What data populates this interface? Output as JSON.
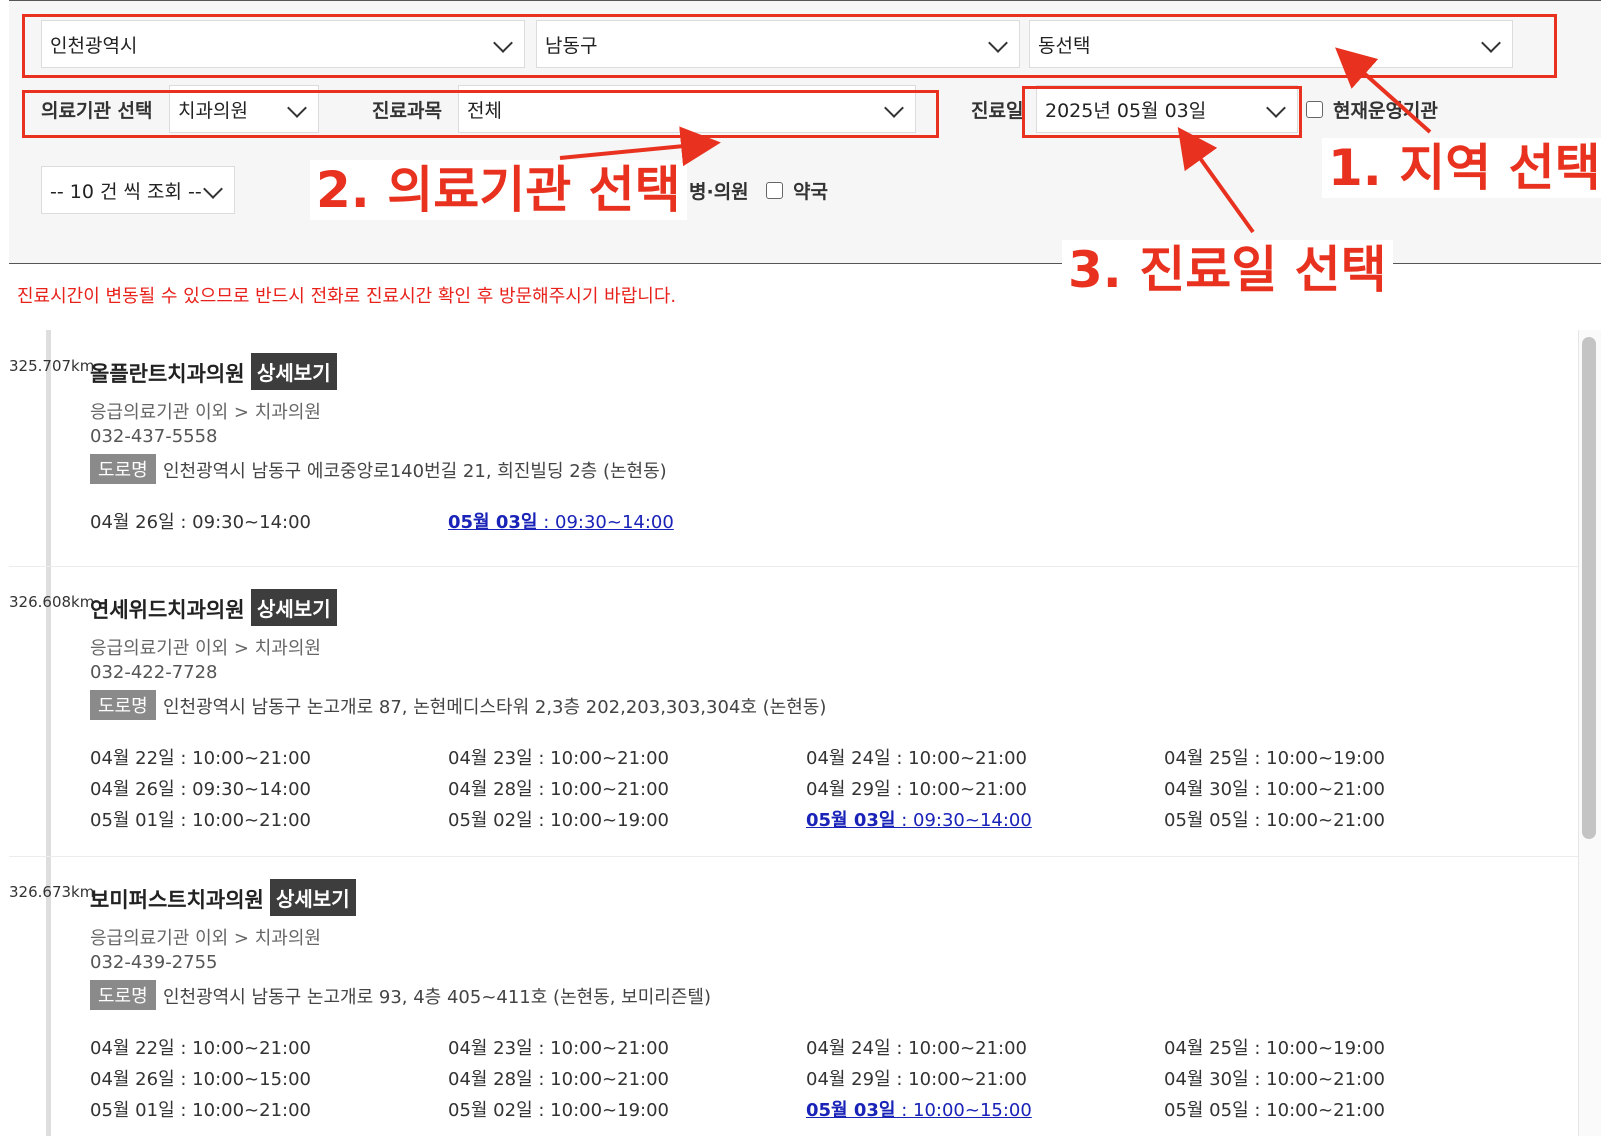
{
  "filters": {
    "city": "인천광역시",
    "district": "남동구",
    "dong": "동선택",
    "institution_label": "의료기관 선택",
    "institution": "치과의원",
    "subject_label": "진료과목",
    "subject": "전체",
    "date_label": "진료일",
    "date": "2025년 05월 03일",
    "open_now_label": "현재운영기관",
    "page_size": "-- 10 건 씩 조회 --",
    "clinic_label": "병·의원",
    "pharmacy_label": "약국"
  },
  "annotations": {
    "step1": "1. 지역 선택",
    "step2": "2. 의료기관 선택",
    "step3": "3. 진료일 선택"
  },
  "notice": "진료시간이 변동될 수 있으므로 반드시 전화로 진료시간 확인 후 방문해주시기 바랍니다.",
  "colors": {
    "annotation": "#e8321f",
    "notice": "#e8211b",
    "today_link": "#1a23b8",
    "checkbox": "#1a73e8"
  },
  "detail_label": "상세보기",
  "road_label": "도로명",
  "items": [
    {
      "distance": "325.707km",
      "name": "올플란트치과의원",
      "category": "응급의료기관 이외 > 치과의원",
      "phone": "032-437-5558",
      "address": "인천광역시 남동구 에코중앙로140번길 21, 희진빌딩 2층 (논현동)",
      "hours": [
        {
          "day": "04월 26일",
          "time": " : 09:30~14:00",
          "today": false
        },
        {
          "day": "05월 03일",
          "time": " : 09:30~14:00",
          "today": true
        }
      ]
    },
    {
      "distance": "326.608km",
      "name": "연세위드치과의원",
      "category": "응급의료기관 이외 > 치과의원",
      "phone": "032-422-7728",
      "address": "인천광역시 남동구 논고개로 87, 논현메디스타워 2,3층 202,203,303,304호 (논현동)",
      "hours": [
        {
          "day": "04월 22일",
          "time": " : 10:00~21:00",
          "today": false
        },
        {
          "day": "04월 23일",
          "time": " : 10:00~21:00",
          "today": false
        },
        {
          "day": "04월 24일",
          "time": " : 10:00~21:00",
          "today": false
        },
        {
          "day": "04월 25일",
          "time": " : 10:00~19:00",
          "today": false
        },
        {
          "day": "04월 26일",
          "time": " : 09:30~14:00",
          "today": false
        },
        {
          "day": "04월 28일",
          "time": " : 10:00~21:00",
          "today": false
        },
        {
          "day": "04월 29일",
          "time": " : 10:00~21:00",
          "today": false
        },
        {
          "day": "04월 30일",
          "time": " : 10:00~21:00",
          "today": false
        },
        {
          "day": "05월 01일",
          "time": " : 10:00~21:00",
          "today": false
        },
        {
          "day": "05월 02일",
          "time": " : 10:00~19:00",
          "today": false
        },
        {
          "day": "05월 03일",
          "time": " : 09:30~14:00",
          "today": true
        },
        {
          "day": "05월 05일",
          "time": " : 10:00~21:00",
          "today": false
        }
      ]
    },
    {
      "distance": "326.673km",
      "name": "보미퍼스트치과의원",
      "category": "응급의료기관 이외 > 치과의원",
      "phone": "032-439-2755",
      "address": "인천광역시 남동구 논고개로 93, 4층 405~411호 (논현동, 보미리즌텔)",
      "hours": [
        {
          "day": "04월 22일",
          "time": " : 10:00~21:00",
          "today": false
        },
        {
          "day": "04월 23일",
          "time": " : 10:00~21:00",
          "today": false
        },
        {
          "day": "04월 24일",
          "time": " : 10:00~21:00",
          "today": false
        },
        {
          "day": "04월 25일",
          "time": " : 10:00~19:00",
          "today": false
        },
        {
          "day": "04월 26일",
          "time": " : 10:00~15:00",
          "today": false
        },
        {
          "day": "04월 28일",
          "time": " : 10:00~21:00",
          "today": false
        },
        {
          "day": "04월 29일",
          "time": " : 10:00~21:00",
          "today": false
        },
        {
          "day": "04월 30일",
          "time": " : 10:00~21:00",
          "today": false
        },
        {
          "day": "05월 01일",
          "time": " : 10:00~21:00",
          "today": false
        },
        {
          "day": "05월 02일",
          "time": " : 10:00~19:00",
          "today": false
        },
        {
          "day": "05월 03일",
          "time": " : 10:00~15:00",
          "today": true
        },
        {
          "day": "05월 05일",
          "time": " : 10:00~21:00",
          "today": false
        }
      ]
    }
  ]
}
